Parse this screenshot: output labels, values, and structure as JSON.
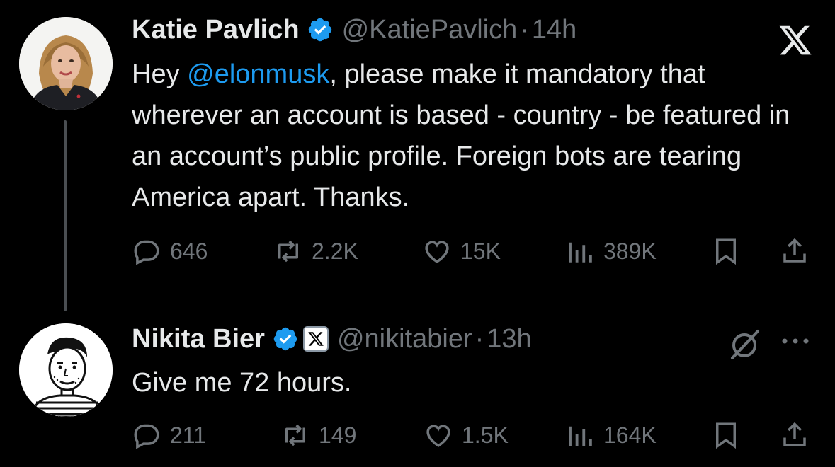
{
  "colors": {
    "background": "#000000",
    "text": "#e7e9ea",
    "secondary": "#71767b",
    "accent": "#1d9bf0",
    "thread_line": "#4a4e52"
  },
  "tweets": [
    {
      "display_name": "Katie Pavlich",
      "handle": "@KatiePavlich",
      "separator": "·",
      "time": "14h",
      "verified": "verified-badge-icon",
      "body": {
        "prefix": "Hey ",
        "mention": "@elonmusk",
        "suffix": ", please make it mandatory that wherever an account is based - country - be featured in an account’s public profile. Foreign bots are tearing America apart. Thanks."
      },
      "counts": {
        "replies": "646",
        "reposts": "2.2K",
        "likes": "15K",
        "views": "389K"
      },
      "corner_icon": "x-logo-icon"
    },
    {
      "display_name": "Nikita Bier",
      "handle": "@nikitabier",
      "separator": "·",
      "time": "13h",
      "verified": "verified-badge-icon",
      "affiliate": "x-affiliate-badge-icon",
      "body": {
        "text": "Give me 72 hours."
      },
      "counts": {
        "replies": "211",
        "reposts": "149",
        "likes": "1.5K",
        "views": "164K"
      },
      "corner_icons": [
        "grok-icon",
        "more-icon"
      ]
    }
  ]
}
